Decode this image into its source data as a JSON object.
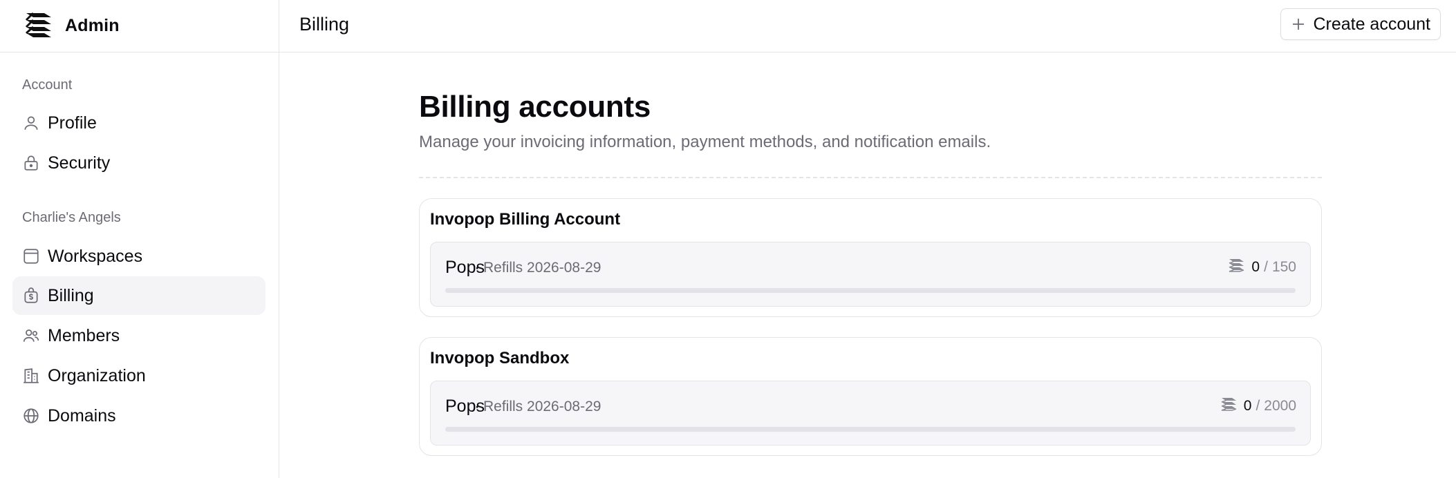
{
  "brand": {
    "name": "Admin",
    "icon": "stack-logo-icon"
  },
  "sidebar": {
    "sections": [
      {
        "label": "Account",
        "items": [
          {
            "label": "Profile",
            "icon": "user-icon",
            "active": false
          },
          {
            "label": "Security",
            "icon": "lock-icon",
            "active": false
          }
        ]
      },
      {
        "label": "Charlie's Angels",
        "items": [
          {
            "label": "Workspaces",
            "icon": "window-icon",
            "active": false
          },
          {
            "label": "Billing",
            "icon": "dollar-bag-icon",
            "active": true
          },
          {
            "label": "Members",
            "icon": "users-icon",
            "active": false
          },
          {
            "label": "Organization",
            "icon": "building-icon",
            "active": false
          },
          {
            "label": "Domains",
            "icon": "globe-icon",
            "active": false
          }
        ]
      }
    ]
  },
  "topbar": {
    "title": "Billing",
    "create_button": "Create account"
  },
  "main": {
    "title": "Billing accounts",
    "subtitle": "Manage your invoicing information, payment methods, and notification emails.",
    "accounts": [
      {
        "name": "Invopop Billing Account",
        "pops_label": "Pops",
        "separator": "·",
        "refills": "Refills 2026-08-29",
        "used": "0",
        "slash": "/",
        "total": "150",
        "fraction": 0
      },
      {
        "name": "Invopop Sandbox",
        "pops_label": "Pops",
        "separator": "·",
        "refills": "Refills 2026-08-29",
        "used": "0",
        "slash": "/",
        "total": "2000",
        "fraction": 0
      }
    ]
  },
  "colors": {
    "text": "#0b0b0f",
    "muted": "#6b6b75",
    "active_bg": "#f4f4f6",
    "border": "#e4e4e8"
  }
}
